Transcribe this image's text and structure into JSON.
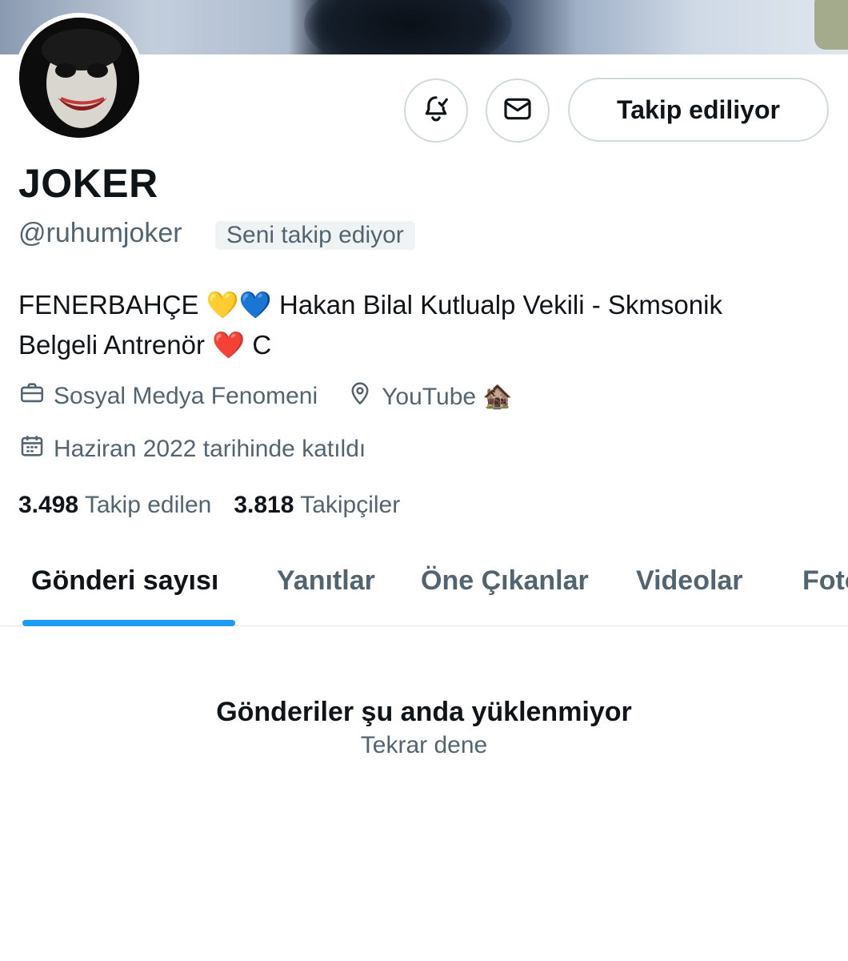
{
  "profile": {
    "name": "JOKER",
    "handle": "@ruhumjoker",
    "follows_you_badge": "Seni takip ediyor",
    "bio_line1": "FENERBAHÇE 💛💙 Hakan Bilal Kutlualp Vekili - Skmsonik",
    "bio_line2": "Belgeli Antrenör ❤️ C",
    "profession": "Sosyal Medya Fenomeni",
    "location": "YouTube 🏚️",
    "joined": "Haziran 2022 tarihinde katıldı",
    "following_count": "3.498",
    "following_label": "Takip edilen",
    "followers_count": "3.818",
    "followers_label": "Takipçiler"
  },
  "actions": {
    "notify_icon": "bell-check-icon",
    "message_icon": "envelope-icon",
    "follow_label": "Takip ediliyor"
  },
  "tabs": [
    {
      "label": "Gönderi sayısı",
      "active": true
    },
    {
      "label": "Yanıtlar",
      "active": false
    },
    {
      "label": "Öne Çıkanlar",
      "active": false
    },
    {
      "label": "Videolar",
      "active": false
    },
    {
      "label": "Foto",
      "active": false
    }
  ],
  "empty_state": {
    "title": "Gönderiler şu anda yüklenmiyor",
    "retry": "Tekrar dene"
  },
  "colors": {
    "accent": "#1d9bf0",
    "text_primary": "#0f1419",
    "text_secondary": "#536471",
    "border": "#cfd9de"
  }
}
